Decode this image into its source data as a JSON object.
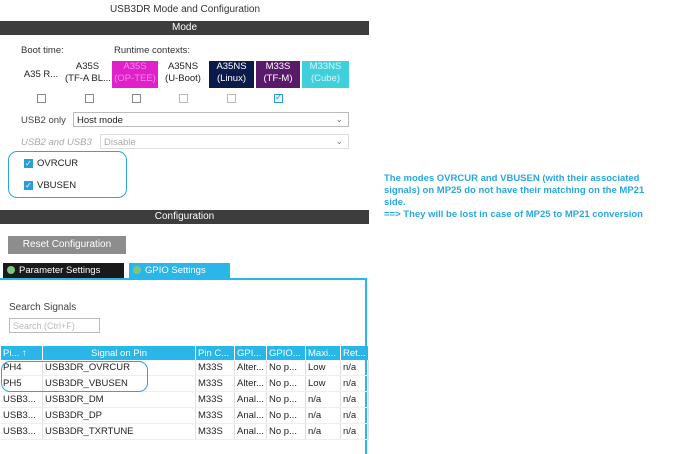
{
  "window_title": "USB3DR Mode and Configuration",
  "mode_section": "Mode",
  "boot_time_label": "Boot time:",
  "runtime_contexts_label": "Runtime contexts:",
  "contexts": [
    {
      "label_line1": "A35 R...",
      "label_line2": "",
      "bg": "#ffffff",
      "fg": "#222222",
      "checkbox": "unchecked"
    },
    {
      "label_line1": "A35S",
      "label_line2": "(TF-A BL...",
      "bg": "#ffffff",
      "fg": "#222222",
      "checkbox": "unchecked"
    },
    {
      "label_line1": "A35S",
      "label_line2": "(OP-TEE)",
      "bg": "#e020c8",
      "fg": "#f48ae8",
      "checkbox": "unchecked"
    },
    {
      "label_line1": "A35NS",
      "label_line2": "(U-Boot)",
      "bg": "#ffffff",
      "fg": "#222222",
      "checkbox": "disabled"
    },
    {
      "label_line1": "A35NS",
      "label_line2": "(Linux)",
      "bg": "#0a1a4a",
      "fg": "#ffffff",
      "checkbox": "disabled"
    },
    {
      "label_line1": "M33S",
      "label_line2": "(TF-M)",
      "bg": "#5a1a6a",
      "fg": "#ffffff",
      "checkbox": "checked"
    },
    {
      "label_line1": "M33NS",
      "label_line2": "(Cube)",
      "bg": "#3fd0dc",
      "fg": "#d8f6f8",
      "checkbox": "none"
    }
  ],
  "usb2_only_label": "USB2 only",
  "usb2_only_value": "Host mode",
  "usb2_usb3_label": "USB2 and USB3",
  "usb2_usb3_value": "Disable",
  "ovrcur_label": "OVRCUR",
  "vbusen_label": "VBUSEN",
  "config_section": "Configuration",
  "reset_button": "Reset Configuration",
  "tabs": {
    "parameter": "Parameter Settings",
    "gpio": "GPIO Settings"
  },
  "search_label": "Search Signals",
  "search_placeholder": "Search (Ctrl+F)",
  "table": {
    "headers": [
      "Pi...",
      "Signal on Pin",
      "Pin C...",
      "GPI...",
      "GPIO...",
      "Maxi...",
      "Ret..."
    ],
    "rows": [
      [
        "PH4",
        "USB3DR_OVRCUR",
        "M33S",
        "Alter...",
        "No p...",
        "Low",
        "n/a"
      ],
      [
        "PH5",
        "USB3DR_VBUSEN",
        "M33S",
        "Alter...",
        "No p...",
        "Low",
        "n/a"
      ],
      [
        "USB3...",
        "USB3DR_DM",
        "M33S",
        "Anal...",
        "No p...",
        "n/a",
        "n/a"
      ],
      [
        "USB3...",
        "USB3DR_DP",
        "M33S",
        "Anal...",
        "No p...",
        "n/a",
        "n/a"
      ],
      [
        "USB3...",
        "USB3DR_TXRTUNE",
        "M33S",
        "Anal...",
        "No p...",
        "n/a",
        "n/a"
      ]
    ]
  },
  "annotation_lines": [
    "The modes OVRCUR and VBUSEN (with their associated",
    "signals) on MP25 do not have their matching on the MP21",
    "side.",
    "==> They will be lost in case of MP25 to MP21 conversion"
  ]
}
